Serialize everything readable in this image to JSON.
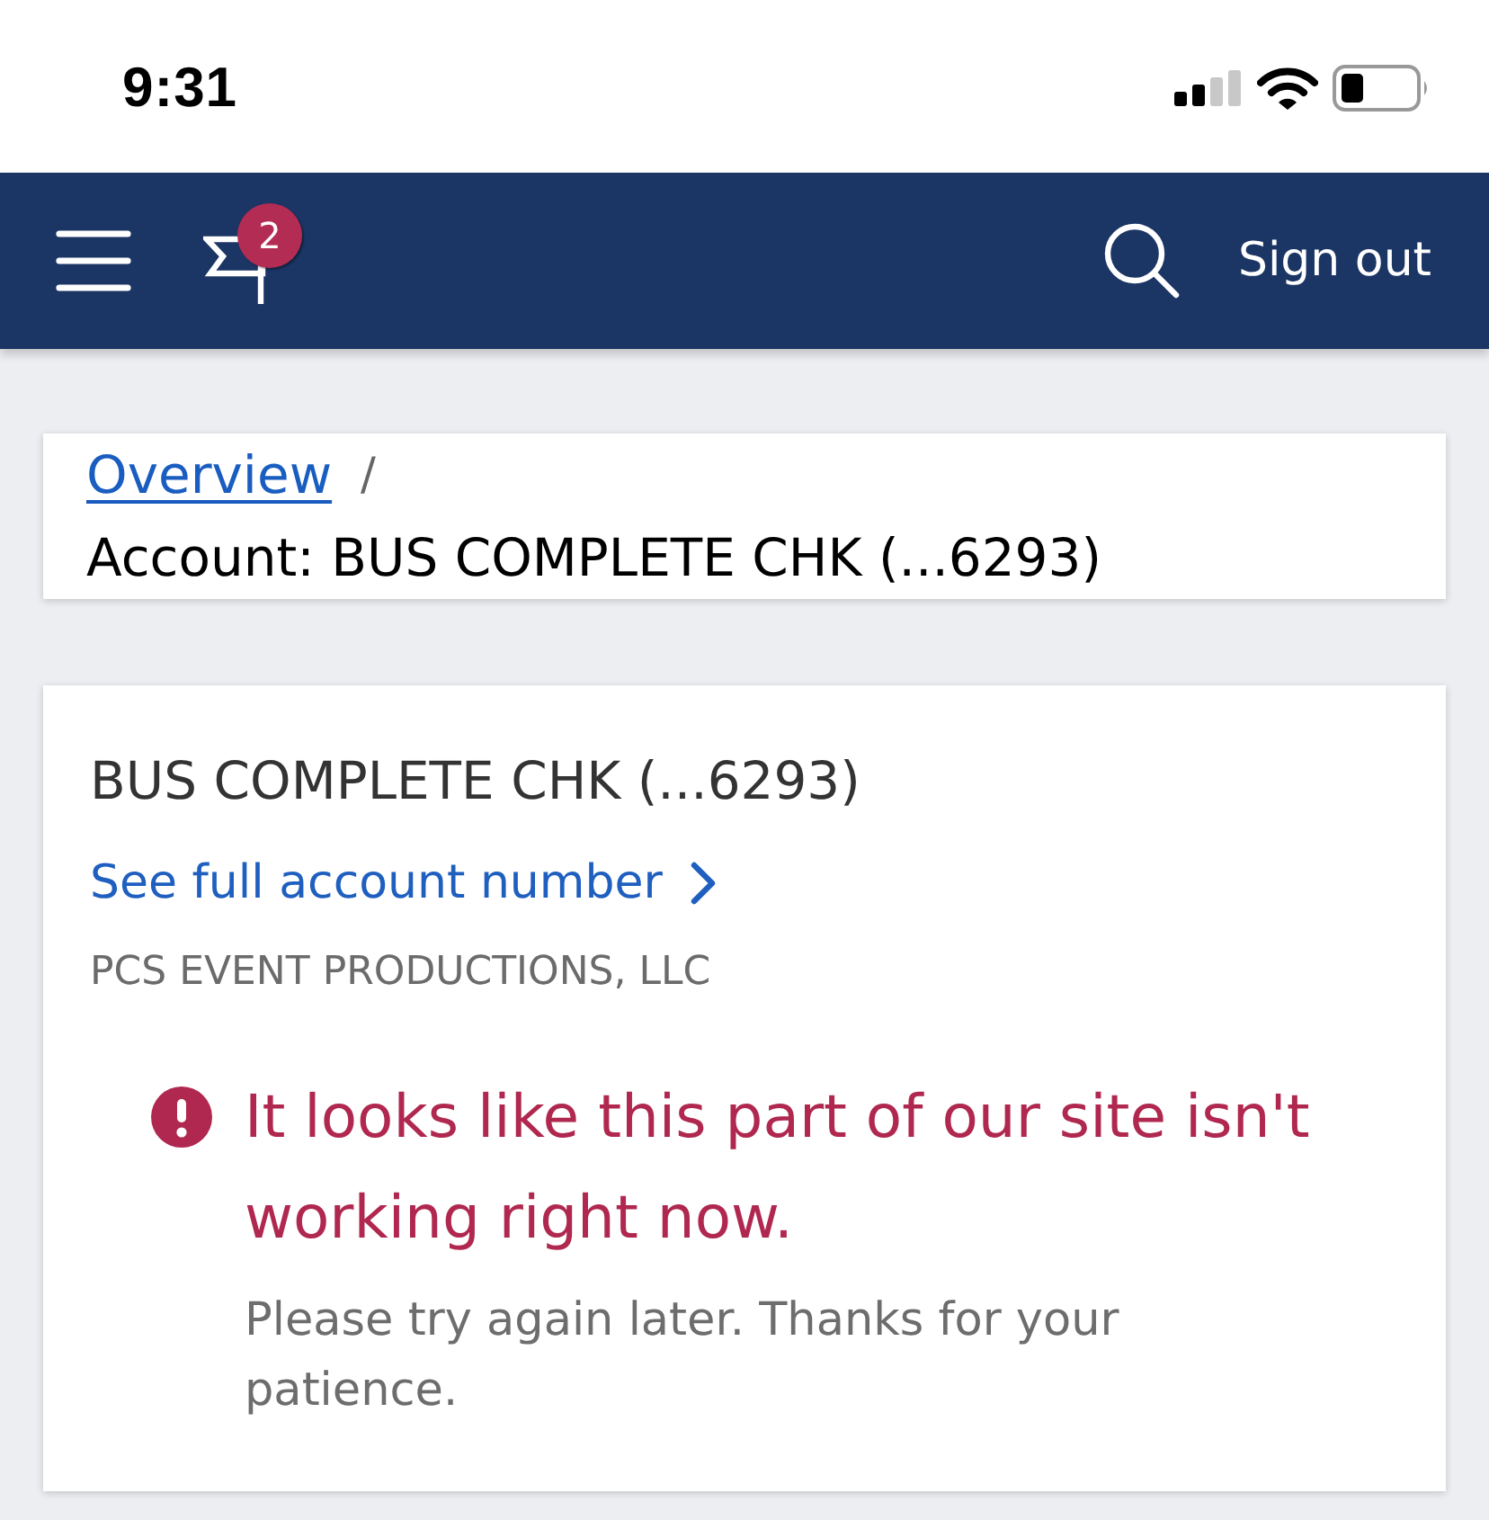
{
  "status_bar": {
    "time": "9:31"
  },
  "nav": {
    "notification_count": "2",
    "sign_out": "Sign out"
  },
  "breadcrumb": {
    "link": "Overview",
    "separator": "/",
    "current": "Account: BUS COMPLETE CHK (...6293)"
  },
  "account": {
    "name": "BUS COMPLETE CHK (...6293)",
    "link": "See full account number",
    "owner": "PCS EVENT PRODUCTIONS, LLC"
  },
  "error": {
    "title": "It looks like this part of our site isn't working right now.",
    "message": "Please try again later. Thanks for your patience."
  }
}
